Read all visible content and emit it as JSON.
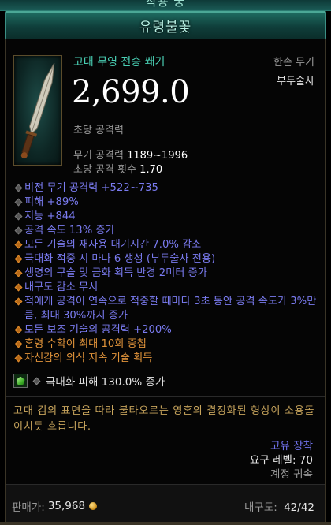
{
  "header": {
    "top_text": "작용 궁",
    "item_name": "유령불꽃"
  },
  "item": {
    "type_line": "고대 무영 전승 쐐기",
    "category": "한손 무기",
    "class_req": "부두술사",
    "dps": "2,699.0",
    "dps_label": "초당 공격력",
    "weapon_damage_label": "무기 공격력",
    "weapon_damage": "1189~1996",
    "attack_speed_label": "초당 공격 횟수",
    "attack_speed": "1.70"
  },
  "properties": [
    {
      "text": "비전 무기 공격력 +522~735",
      "kind": "primary"
    },
    {
      "text": "피해 +89%",
      "kind": "primary"
    },
    {
      "text": "지능 +844",
      "kind": "primary"
    },
    {
      "text": "공격 속도 13% 증가",
      "kind": "primary"
    },
    {
      "text": "모든 기술의 재사용 대기시간 7.0% 감소",
      "kind": "secondary"
    },
    {
      "text": "극대화 적중 시 마나 6 생성 (부두술사 전용)",
      "kind": "secondary"
    },
    {
      "text": "생명의 구슬 및 금화 획득 반경 2미터 증가",
      "kind": "secondary"
    },
    {
      "text": "내구도 감소 무시",
      "kind": "secondary"
    },
    {
      "text": "적에게 공격이 연속으로 적중할 때마다 3초 동안 공격 속도가 3%만큼, 최대 30%까지 증가",
      "kind": "secondary"
    },
    {
      "text": "모든 보조 기술의 공격력 +200%",
      "kind": "secondary"
    },
    {
      "text": "혼령 수확이 최대 10회 중첩",
      "kind": "legendary"
    },
    {
      "text": "자신감의 의식 지속 기술 획득",
      "kind": "legendary"
    }
  ],
  "socket": {
    "gem_icon": "green-gem-icon",
    "text": "극대화 피해 130.0% 증가"
  },
  "flavor_text": "고대 검의 표면을 따라 불타오르는 영혼의 결정화된 형상이 소용돌이치듯 흐릅니다.",
  "rarity": "고유 장착",
  "required_level": "요구 레벨: 70",
  "bound": "계정 귀속",
  "footer": {
    "sell_label": "판매가:",
    "sell_value": "35,968",
    "durability_label": "내구도:",
    "durability_value": "42/42"
  },
  "colors": {
    "title_teal": "#b9f1e4",
    "type_teal": "#4ad0b5",
    "affix_blue": "#7a7bf0",
    "legendary_orange": "#e0933a",
    "flavor_gold": "#c7a45c"
  }
}
